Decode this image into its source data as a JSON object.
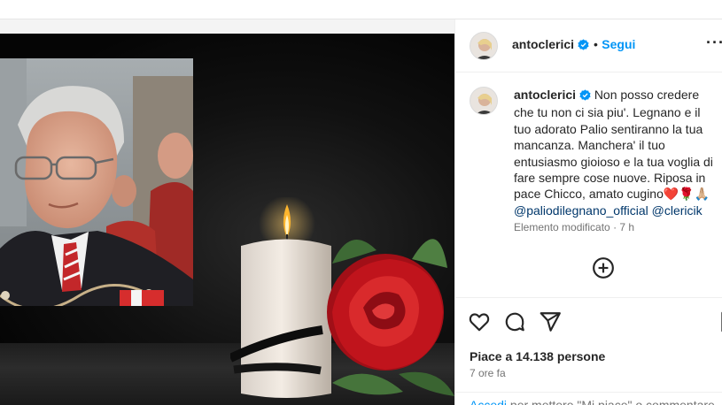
{
  "post": {
    "author": "antoclerici",
    "follow_label": "Segui",
    "separator": "•",
    "more_label": "···",
    "caption": "Non posso credere che tu non ci sia piu'. Legnano e il tuo adorato Palio sentiranno la tua mancanza. Manchera' il tuo entusiasmo gioioso e la tua voglia di fare sempre cose nuove. Riposa in pace Chicco, amato cugino",
    "caption_emojis": "❤️🌹🙏🏼",
    "mentions": [
      "@paliodilegnano_official",
      "@clericik"
    ],
    "edited_label": "Elemento modificato",
    "edited_sep": "·",
    "edited_time": "7 h",
    "likes_text": "Piace a 14.138 persone",
    "posted_ago": "7 ore fa",
    "login_link": "Accedi",
    "login_rest": "per mettere \"Mi piace\" o commentare."
  },
  "icons": {
    "verified": "verified-badge-icon",
    "add_comment": "plus-circle-icon",
    "like": "heart-icon",
    "comment": "comment-bubble-icon",
    "share": "paper-plane-icon",
    "save": "bookmark-icon"
  },
  "colors": {
    "link_blue": "#0095f6",
    "mention_blue": "#00376b",
    "rose_red": "#c0141c"
  }
}
